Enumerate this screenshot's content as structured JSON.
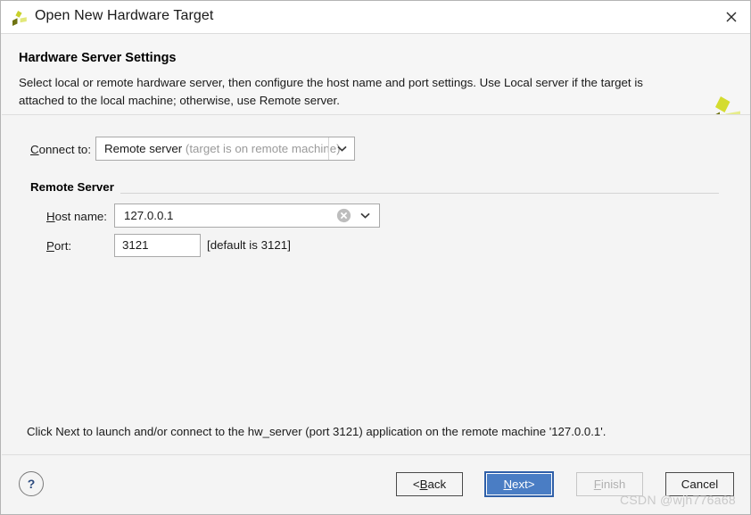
{
  "window": {
    "title": "Open New Hardware Target",
    "app_icon": "vivado-logo-icon",
    "close_label": "×"
  },
  "header": {
    "title": "Hardware Server Settings",
    "description": "Select local or remote hardware server, then configure the host name and port settings. Use Local server if the target is attached to the local machine; otherwise, use Remote server.",
    "logo": "vivado-logo-icon"
  },
  "form": {
    "connect_to": {
      "label_mnemonic": "C",
      "label_rest": "onnect to:",
      "value": "Remote server",
      "value_hint": " (target is on remote machine)"
    },
    "group": {
      "title": "Remote Server"
    },
    "host_name": {
      "label_mnemonic": "H",
      "label_rest": "ost name:",
      "value": "127.0.0.1",
      "clear_icon": "clear-circle-icon",
      "dropdown_icon": "chevron-down-icon"
    },
    "port": {
      "label_mnemonic": "P",
      "label_rest": "ort:",
      "value": "3121",
      "hint": "[default is 3121]"
    }
  },
  "status": {
    "message": "Click Next to launch and/or connect to the hw_server (port 3121) application on the remote machine '127.0.0.1'."
  },
  "footer": {
    "help_label": "?",
    "buttons": {
      "back": {
        "prefix": "< ",
        "mnemonic": "B",
        "rest": "ack"
      },
      "next": {
        "mnemonic": "N",
        "rest": "ext",
        "suffix": " >"
      },
      "finish": {
        "mnemonic": "F",
        "rest": "inish"
      },
      "cancel": {
        "label": "Cancel"
      }
    }
  },
  "watermark": {
    "text": "CSDN @wjh776a68"
  },
  "colors": {
    "accent_blue": "#4a7dc4",
    "accent_blue_border": "#2f5fa8",
    "dialog_bg": "#f4f4f4",
    "logo_dark": "#6f7312",
    "logo_mid": "#c8d12c",
    "logo_light": "#e2e87a"
  }
}
